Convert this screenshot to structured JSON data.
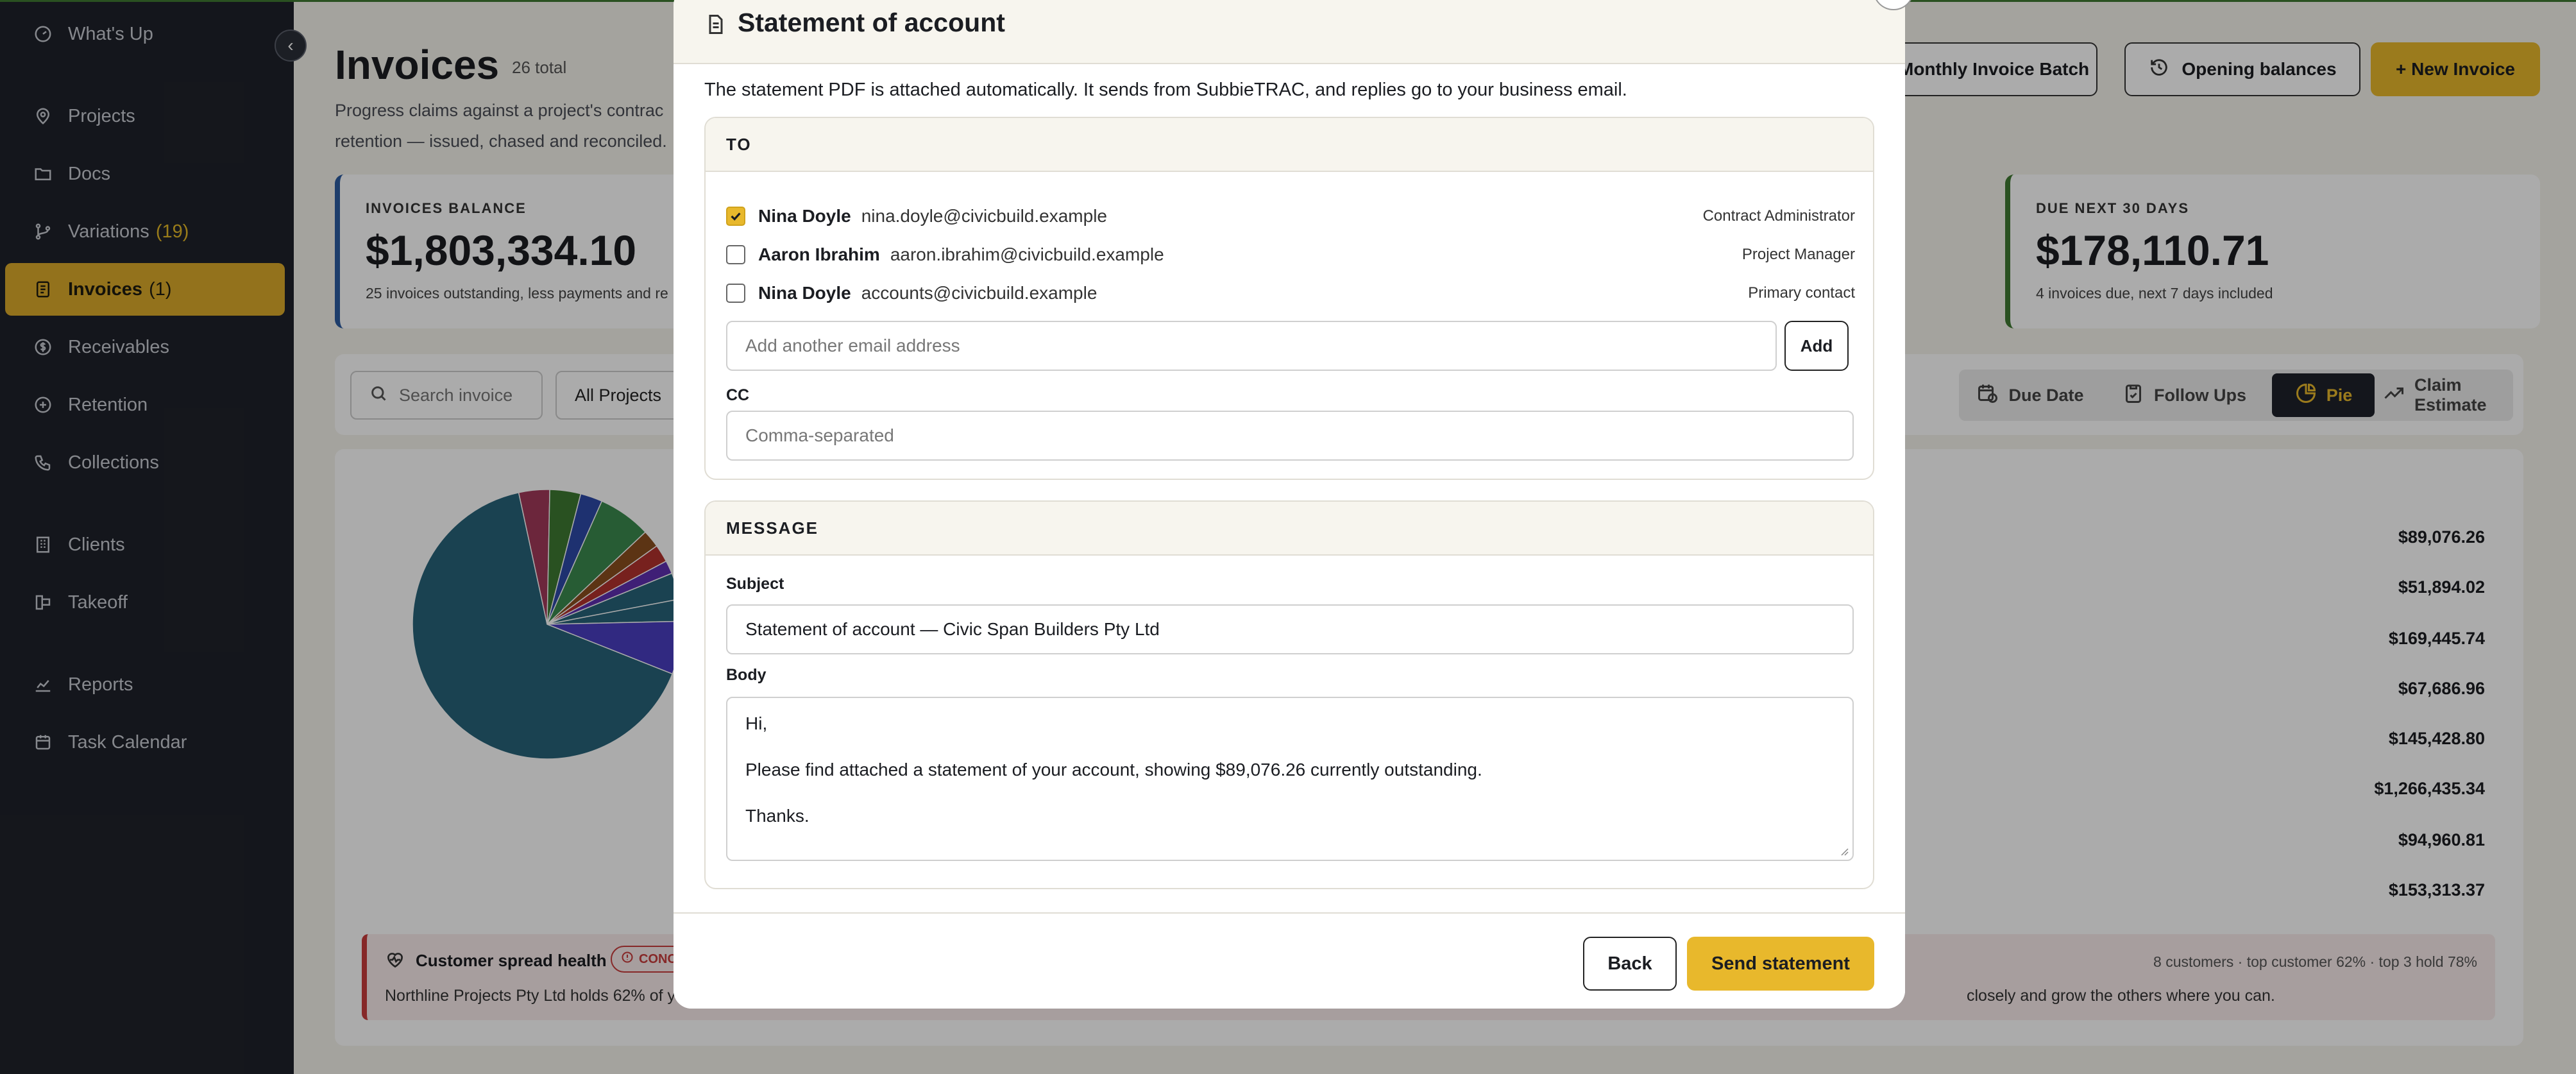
{
  "sidebar": {
    "items": [
      {
        "label": "What's Up",
        "icon": "gauge-icon"
      },
      {
        "label": "Projects",
        "icon": "map-pin-icon"
      },
      {
        "label": "Docs",
        "icon": "folder-icon"
      },
      {
        "label": "Variations",
        "count": "(19)",
        "icon": "branch-icon"
      },
      {
        "label": "Invoices",
        "count": "(1)",
        "icon": "invoice-icon",
        "active": true
      },
      {
        "label": "Receivables",
        "icon": "dollar-circle-icon"
      },
      {
        "label": "Retention",
        "icon": "scale-icon"
      },
      {
        "label": "Collections",
        "icon": "phone-icon"
      },
      {
        "label": "Clients",
        "icon": "building-icon"
      },
      {
        "label": "Takeoff",
        "icon": "ruler-icon"
      },
      {
        "label": "Reports",
        "icon": "chart-line-icon"
      },
      {
        "label": "Task Calendar",
        "icon": "calendar-icon"
      }
    ]
  },
  "header": {
    "title": "Invoices",
    "total": "26 total",
    "subtitle_line1": "Progress claims against a project's contrac",
    "subtitle_line2": "retention — issued, chased and reconciled.",
    "buttons": {
      "monthly_batch": "Monthly Invoice Batch",
      "opening_balances": "Opening balances",
      "new_invoice": "+ New Invoice"
    }
  },
  "cards": {
    "balance": {
      "label": "INVOICES BALANCE",
      "value": "$1,803,334.10",
      "note": "25 invoices outstanding, less payments and re"
    },
    "due_next": {
      "label": "DUE NEXT 30 DAYS",
      "value": "$178,110.71",
      "note": "4 invoices due, next 7 days included"
    }
  },
  "filters": {
    "search_placeholder": "Search invoice",
    "project_filter": "All Projects",
    "views": [
      {
        "label": "Due Date",
        "icon": "calendar-clock-icon"
      },
      {
        "label": "Follow Ups",
        "icon": "clipboard-check-icon"
      },
      {
        "label": "Pie",
        "icon": "pie-chart-icon",
        "active": true
      },
      {
        "label": "Claim Estimate",
        "icon": "trend-up-icon"
      }
    ]
  },
  "chart_data": {
    "type": "pie",
    "values": [
      62,
      3.5,
      3.5,
      2.5,
      6,
      2,
      2,
      1.5,
      3,
      2.5,
      6
    ],
    "colors": [
      "#27637a",
      "#a13a5a",
      "#3e7a32",
      "#2e49a8",
      "#3b8a4e",
      "#8a4e1e",
      "#b2322e",
      "#5e2fb0",
      "#27637a",
      "#27637a",
      "#4a3ec0"
    ],
    "amounts": [
      "$89,076.26",
      "$51,894.02",
      "$169,445.74",
      "$67,686.96",
      "$145,428.80",
      "$1,266,435.34",
      "$94,960.81",
      "$153,313.37"
    ]
  },
  "health": {
    "title": "Customer spread health",
    "badge": "CONCENTRATED",
    "description": "Northline Projects Pty Ltd holds 62% of y",
    "description_end": "closely and grow the others where you can.",
    "stats": "8 customers · top customer 62% · top 3 hold 78%"
  },
  "modal": {
    "title": "Statement of account",
    "intro": "The statement PDF is attached automatically. It sends from SubbieTRAC, and replies go to your business email.",
    "to_heading": "TO",
    "recipients": [
      {
        "name": "Nina Doyle",
        "email": "nina.doyle@civicbuild.example",
        "role": "Contract Administrator",
        "checked": true
      },
      {
        "name": "Aaron Ibrahim",
        "email": "aaron.ibrahim@civicbuild.example",
        "role": "Project Manager",
        "checked": false
      },
      {
        "name": "Nina Doyle",
        "email": "accounts@civicbuild.example",
        "role": "Primary contact",
        "checked": false
      }
    ],
    "add_email_placeholder": "Add another email address",
    "add_button": "Add",
    "cc_label": "CC",
    "cc_placeholder": "Comma-separated",
    "message_heading": "MESSAGE",
    "subject_label": "Subject",
    "subject_value": "Statement of account — Civic Span Builders Pty Ltd",
    "body_label": "Body",
    "body_lines": [
      "Hi,",
      "",
      "Please find attached a statement of your account, showing $89,076.26 currently outstanding.",
      "",
      "Thanks."
    ],
    "back_button": "Back",
    "send_button": "Send statement"
  }
}
